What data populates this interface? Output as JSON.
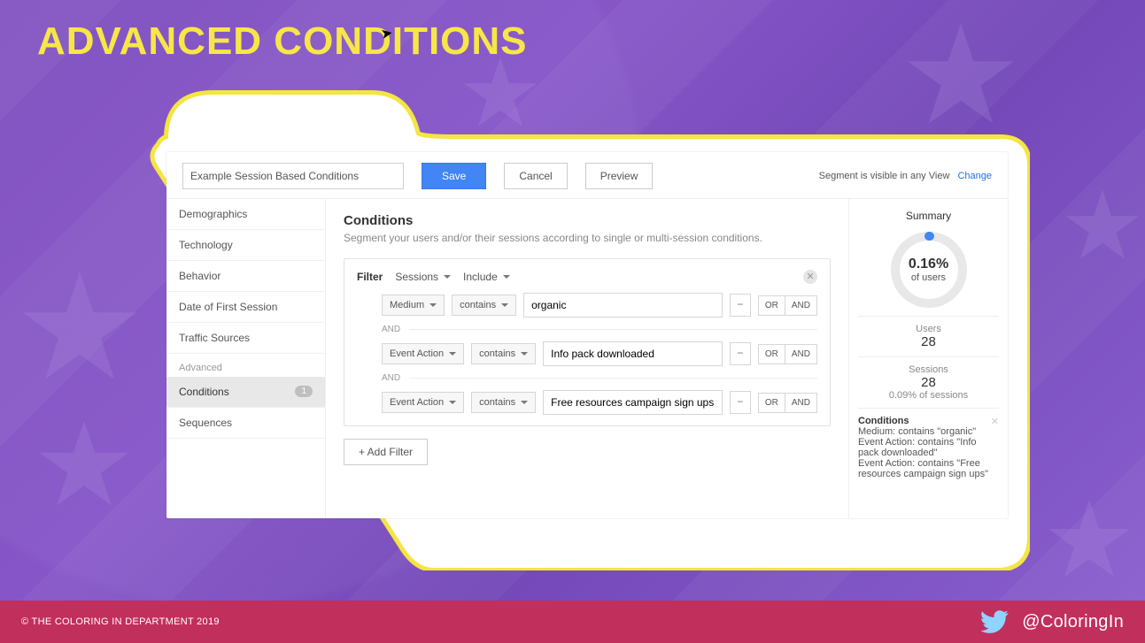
{
  "slide": {
    "title": "ADVANCED CONDITIONS"
  },
  "footer": {
    "copyright": "© THE COLORING IN DEPARTMENT 2019",
    "handle": "@ColoringIn"
  },
  "ga": {
    "segment_name": "Example Session Based Conditions",
    "buttons": {
      "save": "Save",
      "cancel": "Cancel",
      "preview": "Preview"
    },
    "visibility_text": "Segment is visible in any View",
    "visibility_link": "Change",
    "sidebar": {
      "items": [
        "Demographics",
        "Technology",
        "Behavior",
        "Date of First Session",
        "Traffic Sources"
      ],
      "advanced_label": "Advanced",
      "advanced_items": [
        {
          "label": "Conditions",
          "badge": "1",
          "active": true
        },
        {
          "label": "Sequences",
          "badge": "",
          "active": false
        }
      ]
    },
    "main": {
      "heading": "Conditions",
      "subheading": "Segment your users and/or their sessions according to single or multi-session conditions.",
      "filter_label": "Filter",
      "scope": "Sessions",
      "include": "Include",
      "and_label": "AND",
      "rows": [
        {
          "dimension": "Medium",
          "op": "contains",
          "value": "organic"
        },
        {
          "dimension": "Event Action",
          "op": "contains",
          "value": "Info pack downloaded"
        },
        {
          "dimension": "Event Action",
          "op": "contains",
          "value": "Free resources campaign sign ups"
        }
      ],
      "or": "OR",
      "and": "AND",
      "add_filter": "+ Add Filter"
    },
    "summary": {
      "title": "Summary",
      "percent": "0.16%",
      "of_users": "of users",
      "users_label": "Users",
      "users": "28",
      "sessions_label": "Sessions",
      "sessions": "28",
      "sessions_pct": "0.09% of sessions",
      "cond_title": "Conditions",
      "cond_lines": [
        "Medium: contains \"organic\"",
        "Event Action: contains \"Info pack downloaded\"",
        "Event Action: contains \"Free resources campaign sign ups\""
      ]
    }
  }
}
